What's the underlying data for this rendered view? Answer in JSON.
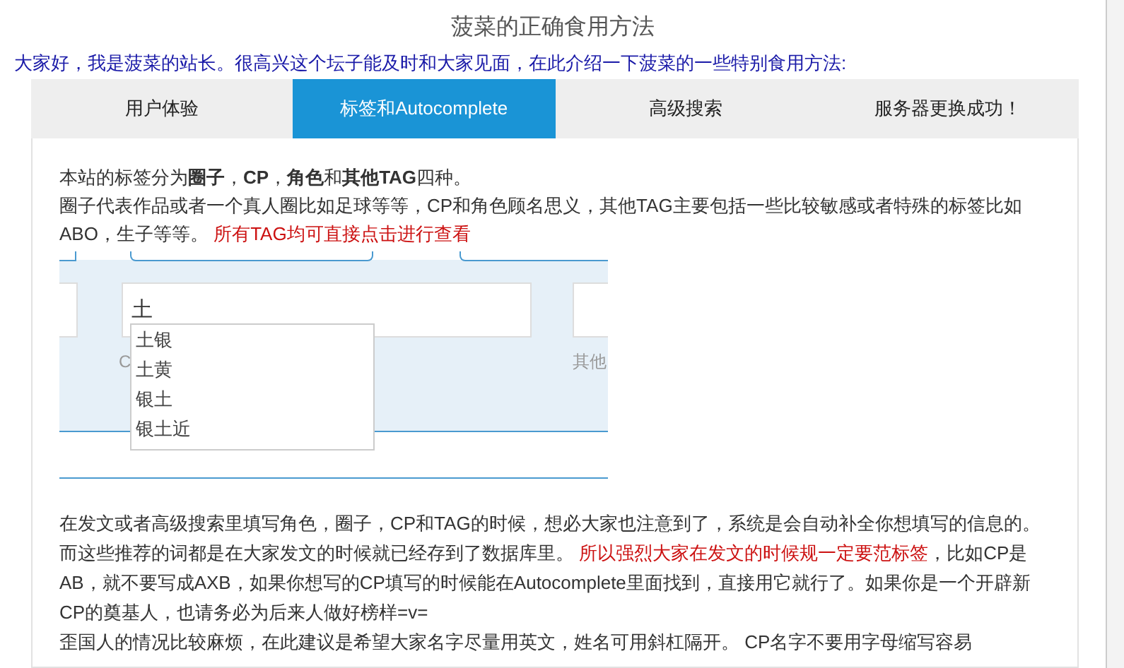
{
  "window": {
    "title": "菠菜的正确食用方法"
  },
  "intro": "大家好，我是菠菜的站长。很高兴这个坛子能及时和大家见面，在此介绍一下菠菜的一些特别食用方法:",
  "tabs": [
    {
      "label": "用户体验",
      "selected": false
    },
    {
      "label": "标签和Autocomplete",
      "selected": true
    },
    {
      "label": "高级搜索",
      "selected": false
    },
    {
      "label": "服务器更换成功！",
      "selected": false
    }
  ],
  "paragraph_1": {
    "lead": "本站的标签分为**圈子**，**CP**，**角色**和**其他TAG**四种。",
    "body": "圈子代表作品或者一个真人圈比如足球等等，CP和角色顾名思义，其他TAG主要包括一些比较敏感或者特殊的标签比如ABO，生子等等。 ",
    "note": "所有TAG均可直接点击进行查看"
  },
  "screenshot": {
    "input_value": "土",
    "suggestions": [
      "土银",
      "土黄",
      "银土",
      "银土近"
    ],
    "labels": [
      "C",
      "其他"
    ]
  },
  "paragraph_2": [
    {
      "text": "在发文或者高级搜索里填写角色，圈子，CP和TAG的时候，想必大家也注意到了，系统是会自动补全你想填写的信息的。而这些推荐的词都是在大家发文的时候就已经存到了数据库里。 ",
      "highlight": false
    },
    {
      "text": "所以强烈大家在发文的时候规一定要范标签",
      "highlight": true
    },
    {
      "text": "，比如CP是AB，就不要写成AXB，如果你想写的CP填写的时候能在Autocomplete里面找到，直接用它就行了。如果你是一个开辟新CP的奠基人，也请务必为后来人做好榜样=v=",
      "highlight": false
    }
  ],
  "paragraph_3": "歪国人的情况比较麻烦，在此建议是希望大家名字尽量用英文，姓名可用斜杠隔开。 CP名字不要用字母缩写容易"
}
